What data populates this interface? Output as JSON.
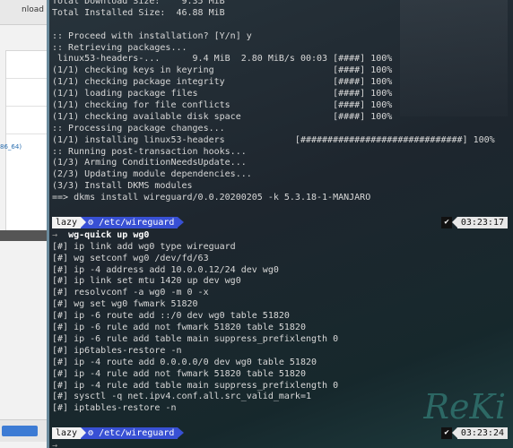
{
  "background_window": {
    "header_text": "nload",
    "link_text": "86_64)"
  },
  "terminal": {
    "output": [
      "Total Download Size:    9.35 MiB",
      "Total Installed Size:  46.88 MiB",
      "",
      ":: Proceed with installation? [Y/n] y",
      ":: Retrieving packages...",
      " linux53-headers-...      9.4 MiB  2.80 MiB/s 00:03 [####] 100%",
      "(1/1) checking keys in keyring                      [####] 100%",
      "(1/1) checking package integrity                    [####] 100%",
      "(1/1) loading package files                         [####] 100%",
      "(1/1) checking for file conflicts                   [####] 100%",
      "(1/1) checking available disk space                 [####] 100%",
      ":: Processing package changes...",
      "(1/1) installing linux53-headers             [##############################] 100%",
      ":: Running post-transaction hooks...",
      "(1/3) Arming ConditionNeedsUpdate...",
      "(2/3) Updating module dependencies...",
      "(3/3) Install DKMS modules",
      "==> dkms install wireguard/0.0.20200205 -k 5.3.18-1-MANJARO"
    ],
    "prompt1": {
      "user": "lazy",
      "path": "⚙ /etc/wireguard",
      "check": "✔",
      "time": "03:23:17"
    },
    "command1_prefix": "→",
    "command1": "wg-quick up wg0",
    "command_output": [
      "[#] ip link add wg0 type wireguard",
      "[#] wg setconf wg0 /dev/fd/63",
      "[#] ip -4 address add 10.0.0.12/24 dev wg0",
      "[#] ip link set mtu 1420 up dev wg0",
      "[#] resolvconf -a wg0 -m 0 -x",
      "[#] wg set wg0 fwmark 51820",
      "[#] ip -6 route add ::/0 dev wg0 table 51820",
      "[#] ip -6 rule add not fwmark 51820 table 51820",
      "[#] ip -6 rule add table main suppress_prefixlength 0",
      "[#] ip6tables-restore -n",
      "[#] ip -4 route add 0.0.0.0/0 dev wg0 table 51820",
      "[#] ip -4 rule add not fwmark 51820 table 51820",
      "[#] ip -4 rule add table main suppress_prefixlength 0",
      "[#] sysctl -q net.ipv4.conf.all.src_valid_mark=1",
      "[#] iptables-restore -n"
    ],
    "prompt2": {
      "user": "lazy",
      "path": "⚙ /etc/wireguard",
      "check": "✔",
      "time": "03:23:24"
    },
    "cursor_prefix": "→"
  }
}
